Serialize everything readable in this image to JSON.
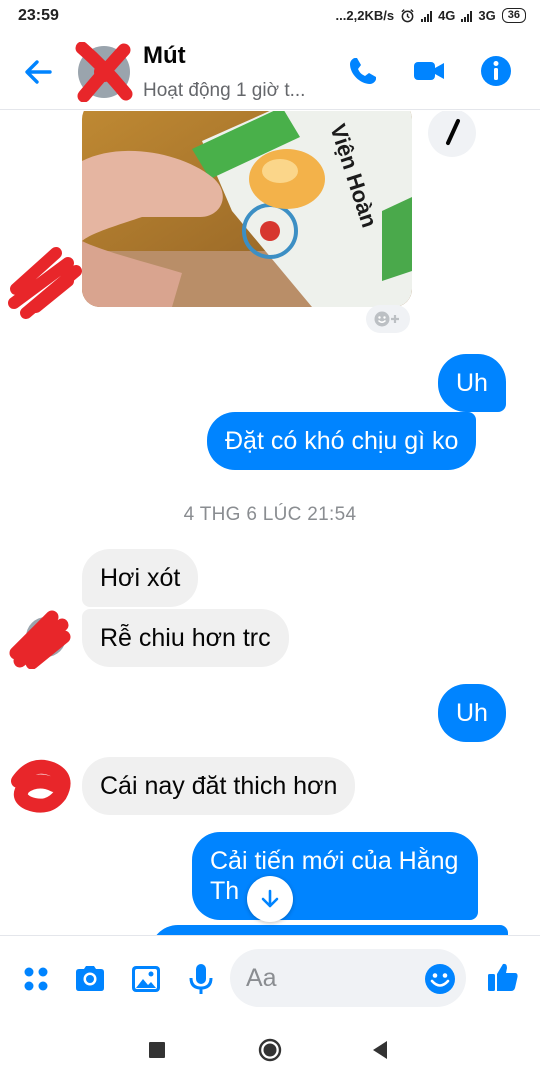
{
  "status_bar": {
    "time": "23:59",
    "network_speed": "...2,2KB/s",
    "net1": "4G",
    "net2": "3G",
    "battery": "36"
  },
  "header": {
    "contact_name": "Mút",
    "presence": "Hoạt động 1 giờ t...",
    "icons": [
      "back-arrow-icon",
      "phone-icon",
      "video-camera-icon",
      "info-icon"
    ]
  },
  "photo_message": {
    "package_text": "Viện Hoàn"
  },
  "messages": [
    {
      "direction": "outgoing",
      "text": "Uh"
    },
    {
      "direction": "outgoing",
      "text": "Đặt có khó chịu gì ko"
    },
    {
      "direction": "incoming",
      "text": "Hơi xót"
    },
    {
      "direction": "incoming",
      "text": "Rễ chiu hơn trc"
    },
    {
      "direction": "outgoing",
      "text": "Uh"
    },
    {
      "direction": "incoming",
      "text": "Cái nay đăt thich hơn"
    },
    {
      "direction": "outgoing",
      "text_line1": "Cải tiến mới của Hằng",
      "text_line2": "Th"
    }
  ],
  "timestamp": "4 THG 6 LÚC 21:54",
  "composer": {
    "placeholder": "Aa",
    "icons": [
      "menu-dots-icon",
      "camera-icon",
      "gallery-icon",
      "microphone-icon",
      "emoji-icon",
      "thumbs-up-icon"
    ]
  },
  "colors": {
    "accent": "#0084ff",
    "incoming_bubble": "#f0f0f0",
    "redaction": "#e8262a"
  }
}
